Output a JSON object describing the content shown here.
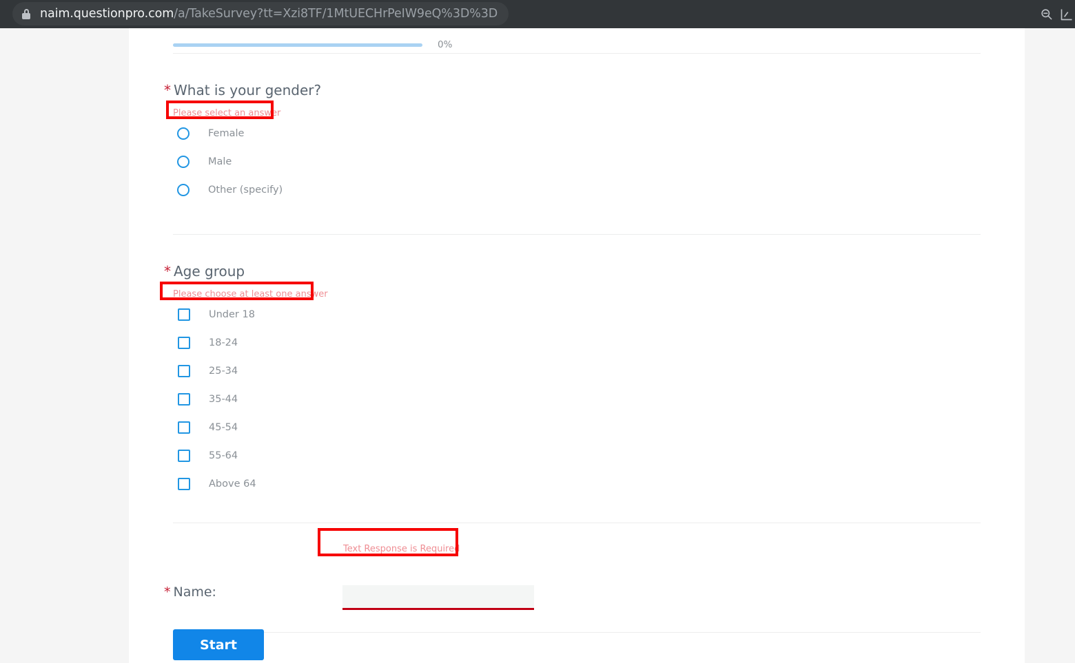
{
  "browser": {
    "url_host": "naim.questionpro.com",
    "url_path": "/a/TakeSurvey?tt=Xzi8TF/1MtUECHrPeIW9eQ%3D%3D",
    "lock_icon": "lock-icon",
    "zoom_out_icon": "zoom-out-icon",
    "extension_icon": "extension-icon"
  },
  "survey": {
    "progress": {
      "percent_label": "0%",
      "value": 0
    },
    "questions": [
      {
        "id": "gender",
        "required_marker": "*",
        "title": "What is your gender?",
        "error": "Please select an answer",
        "type": "radio",
        "options": [
          "Female",
          "Male",
          "Other (specify)"
        ]
      },
      {
        "id": "age-group",
        "required_marker": "*",
        "title": "Age group",
        "error": "Please choose at least one answer",
        "type": "checkbox",
        "options": [
          "Under 18",
          "18-24",
          "25-34",
          "35-44",
          "45-54",
          "55-64",
          "Above 64"
        ]
      },
      {
        "id": "name",
        "required_marker": "*",
        "title": "Name:",
        "error": "Text Response is Required",
        "type": "text",
        "value": "",
        "placeholder": ""
      }
    ],
    "start_button": "Start"
  },
  "colors": {
    "accent_blue": "#1186e8",
    "control_blue": "#2196e3",
    "error_red": "#ef8e94",
    "required_red": "#c62237",
    "annotation_red": "#f60000",
    "input_underline_red": "#c10014",
    "progress_blue": "#a9d2f3"
  }
}
